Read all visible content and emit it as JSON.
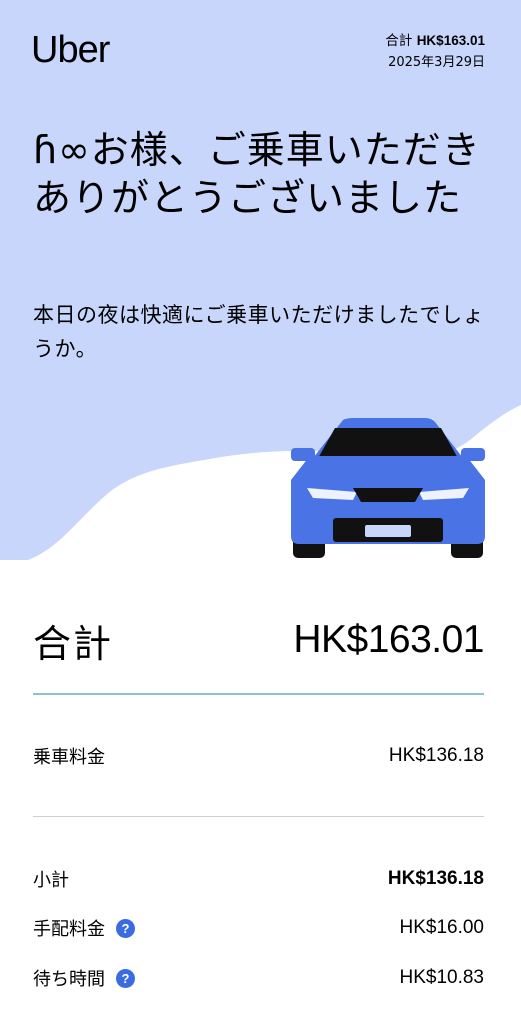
{
  "brand": {
    "logo_text": "Uber"
  },
  "header": {
    "total_label": "合計",
    "total_amount": "HK$163.01",
    "date": "2025年3月29日"
  },
  "hero": {
    "greeting": "ɦ∞お様、ご乗車いただきありがとうございました",
    "subtitle": "本日の夜は快適にご乗車いただけましたでしょうか。"
  },
  "total": {
    "label": "合計",
    "amount": "HK$163.01"
  },
  "fare": {
    "label": "乗車料金",
    "amount": "HK$136.18"
  },
  "breakdown": [
    {
      "label": "小計",
      "amount": "HK$136.18",
      "bold": true,
      "help": false
    },
    {
      "label": "手配料金",
      "amount": "HK$16.00",
      "bold": false,
      "help": true,
      "help_icon": "question-icon",
      "help_glyph": "?"
    },
    {
      "label": "待ち時間",
      "amount": "HK$10.83",
      "bold": false,
      "help": true,
      "help_icon": "question-icon",
      "help_glyph": "?"
    }
  ],
  "colors": {
    "hero_background": "#c8d6fb",
    "car_body": "#4a74e6",
    "car_dark": "#111111",
    "divider_accent": "#8ec1d4",
    "help_icon": "#3a6be0"
  }
}
